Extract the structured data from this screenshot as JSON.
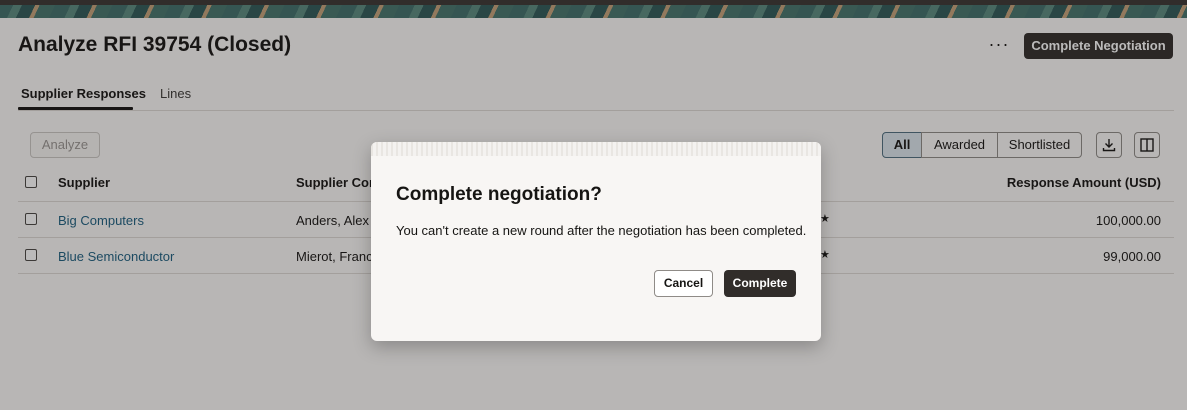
{
  "header": {
    "title": "Analyze RFI 39754 (Closed)",
    "more_label": "···",
    "primary_action": "Complete Negotiation"
  },
  "tabs": [
    {
      "label": "Supplier Responses",
      "active": true
    },
    {
      "label": "Lines",
      "active": false
    }
  ],
  "toolbar": {
    "analyze_label": "Analyze",
    "filters": [
      "All",
      "Awarded",
      "Shortlisted"
    ],
    "selected_filter": "All",
    "download_icon": "download-icon",
    "columns_icon": "columns-panel-icon"
  },
  "table": {
    "columns": [
      "Supplier",
      "Supplier Cont",
      "Response Amount (USD)"
    ],
    "rows": [
      {
        "supplier": "Big Computers",
        "contact": "Anders, Alex",
        "amount": "100,000.00"
      },
      {
        "supplier": "Blue Semiconductor",
        "contact": "Mierot, Franco",
        "amount": "99,000.00"
      }
    ]
  },
  "dialog": {
    "title": "Complete negotiation?",
    "message": "You can't create a new round after the negotiation has been completed.",
    "cancel_label": "Cancel",
    "confirm_label": "Complete"
  },
  "colors": {
    "primary_button": "#312d2a",
    "link": "#1c5f80",
    "selected_filter_bg": "#dbe6ec"
  }
}
